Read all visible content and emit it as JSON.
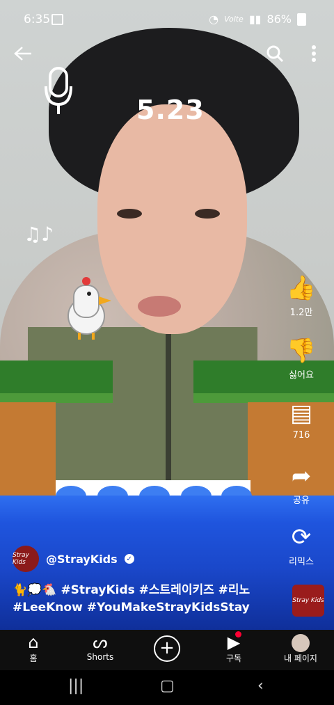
{
  "status_bar": {
    "time": "6:35",
    "network": "Volte",
    "battery": "86%"
  },
  "video": {
    "date_overlay": "5.23"
  },
  "rail": {
    "like_count": "1.2만",
    "dislike_label": "싫어요",
    "comment_count": "716",
    "share_label": "공유",
    "remix_label": "리믹스"
  },
  "channel": {
    "handle": "@StrayKids",
    "avatar_text": "Stray Kids"
  },
  "caption": {
    "emojis": "🐈💭🐔",
    "line1": "#StrayKids #스트레이키즈 #리노",
    "line2": "#LeeKnow #YouMakeStrayKidsStay"
  },
  "nav": {
    "home_label": "홈",
    "shorts_label": "Shorts",
    "subs_label": "구독",
    "mypage_label": "내 페이지"
  },
  "colors": {
    "water": "#1a47c9",
    "grass": "#2f7d2a",
    "dirt": "#c47a33",
    "notify": "#ff0033"
  }
}
